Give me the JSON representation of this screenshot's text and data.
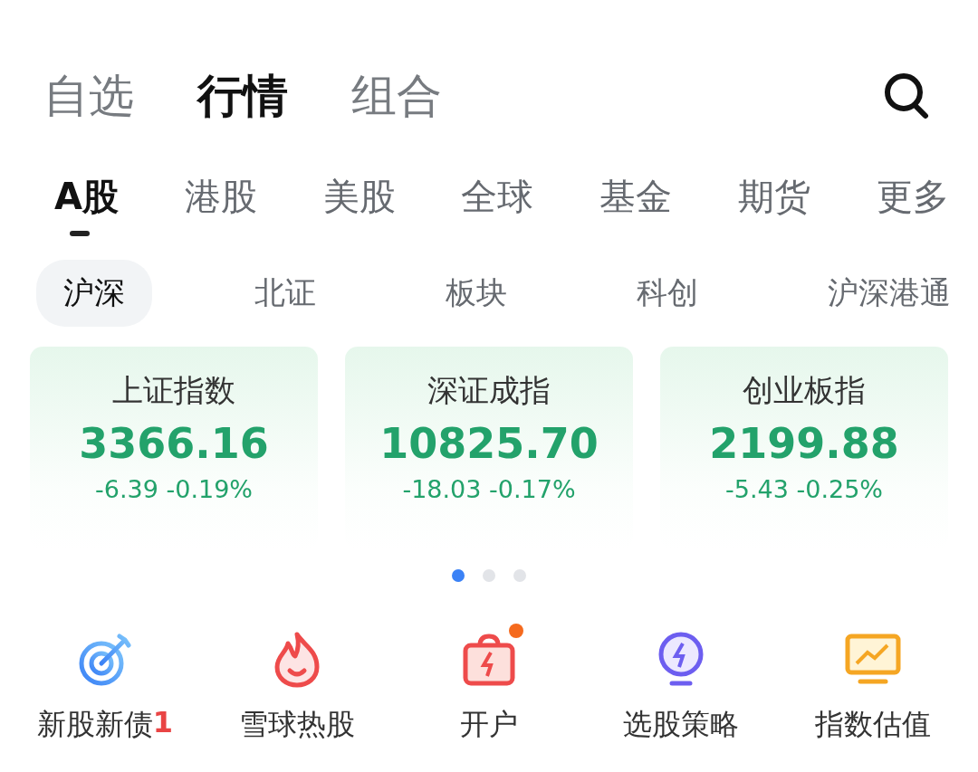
{
  "top_tabs": [
    {
      "label": "自选",
      "selected": false
    },
    {
      "label": "行情",
      "selected": true
    },
    {
      "label": "组合",
      "selected": false
    }
  ],
  "market_tabs": [
    {
      "label": "A股",
      "selected": true
    },
    {
      "label": "港股",
      "selected": false
    },
    {
      "label": "美股",
      "selected": false
    },
    {
      "label": "全球",
      "selected": false
    },
    {
      "label": "基金",
      "selected": false
    },
    {
      "label": "期货",
      "selected": false
    },
    {
      "label": "更多",
      "selected": false
    }
  ],
  "sub_tabs": [
    {
      "label": "沪深",
      "selected": true
    },
    {
      "label": "北证",
      "selected": false
    },
    {
      "label": "板块",
      "selected": false
    },
    {
      "label": "科创",
      "selected": false
    },
    {
      "label": "沪深港通",
      "selected": false
    }
  ],
  "index_cards": [
    {
      "name": "上证指数",
      "value": "3366.16",
      "change": "-6.39 -0.19%"
    },
    {
      "name": "深证成指",
      "value": "10825.70",
      "change": "-18.03 -0.17%"
    },
    {
      "name": "创业板指",
      "value": "2199.88",
      "change": "-5.43 -0.25%"
    }
  ],
  "pager": [
    {
      "selected": true
    },
    {
      "selected": false
    },
    {
      "selected": false
    }
  ],
  "shortcuts": [
    {
      "kind": "target",
      "label": "新股新债",
      "badge": "1",
      "dot": false
    },
    {
      "kind": "flame",
      "label": "雪球热股",
      "dot": false
    },
    {
      "kind": "bag",
      "label": "开户",
      "dot": true
    },
    {
      "kind": "bulb",
      "label": "选股策略",
      "dot": false
    },
    {
      "kind": "monitor",
      "label": "指数估值",
      "dot": false
    }
  ]
}
